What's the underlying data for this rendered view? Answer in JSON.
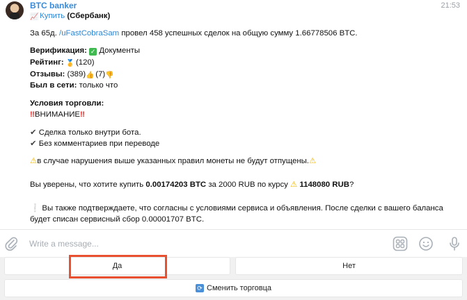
{
  "chat": {
    "sender": "BTC banker",
    "time": "21:53",
    "header_action": "Купить",
    "header_bank": "(Сбербанк)",
    "intro_pre": "За 65д.",
    "intro_user": "/uFastCobraSam",
    "intro_post": "провел 458 успешных сделок на общую сумму 1.66778506 BTC.",
    "verification_label": "Верификация:",
    "verification_value": "Документы",
    "rating_label": "Рейтинг:",
    "rating_value": "(120)",
    "reviews_label": "Отзывы:",
    "reviews_pos": "(389)",
    "reviews_neg": "(7)",
    "online_label": "Был в сети:",
    "online_value": "только что",
    "terms_label": "Условия торговли:",
    "attention": "ВНИМАНИЕ",
    "term1": "Сделка только внутри бота.",
    "term2": "Без комментариев при переводе",
    "warning": "в случае нарушения выше указанных правил монеты не будут отпущены.",
    "confirm_pre": "Вы уверены, что хотите купить",
    "confirm_amount": "0.00174203 BTC",
    "confirm_mid": "за 2000 RUB по курсу",
    "confirm_rate": "1148080 RUB",
    "confirm_q": "?",
    "note_line1": "Вы также подтверждаете, что согласны с условиями сервиса и объявления. После сделки с вашего баланса",
    "note_line2": "будет списан сервисный сбор 0.00001707 BTC."
  },
  "input": {
    "placeholder": "Write a message..."
  },
  "keyboard": {
    "yes": "Да",
    "no": "Нет",
    "switch": "Сменить торговца"
  }
}
